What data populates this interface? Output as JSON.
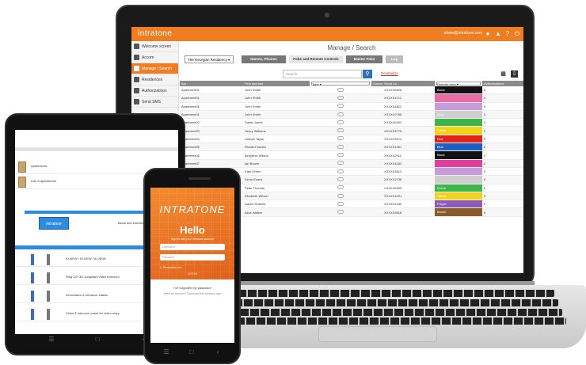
{
  "laptop": {
    "app": {
      "logo": "intratone",
      "user": "olivier@intratone.com",
      "sidebar": [
        {
          "label": "Welcome screen",
          "active": false
        },
        {
          "label": "Accom",
          "active": false
        },
        {
          "label": "Manage / Search",
          "active": true
        },
        {
          "label": "Residences",
          "active": false
        },
        {
          "label": "Authorizations",
          "active": false
        },
        {
          "label": "Send SMS",
          "active": false
        }
      ],
      "page_title": "Manage / Search",
      "filter_select": "The Georgian Residency",
      "tabs": [
        "Names, Phones",
        "Fobs and Remote Controls",
        "Master Fobs",
        "Log"
      ],
      "search_placeholder": "Search",
      "reset_link": "Reinitialize",
      "table": {
        "headers": [
          "Apt.",
          "First and last",
          "Type",
          "Comment",
          "Serial no.",
          "Remote color",
          "Authorizations"
        ],
        "rows": [
          {
            "apt": "Apartment01",
            "name": "John Smith",
            "type": "",
            "serial": "XXXXX6326",
            "color_label": "Black",
            "color": "#111111",
            "auth": "0"
          },
          {
            "apt": "Apartment01",
            "name": "John Smith",
            "type": "",
            "serial": "XXXXX4711",
            "color_label": "",
            "color": "#e86aa3",
            "auth": "0"
          },
          {
            "apt": "Apartment01",
            "name": "John Smith",
            "type": "",
            "serial": "XXXXX4822",
            "color_label": "",
            "color": "#c79ad9",
            "auth": "0"
          },
          {
            "apt": "Apartment01",
            "name": "John Smith",
            "type": "",
            "serial": "XXXXX2798",
            "color_label": "Grey",
            "color": "#cfcfcf",
            "auth": "0"
          },
          {
            "apt": "Apartment02",
            "name": "Sarah Jones",
            "type": "",
            "serial": "XXXXX6402",
            "color_label": "",
            "color": "#3db54a",
            "auth": "0"
          },
          {
            "apt": "Apartment03",
            "name": "Henry Williams",
            "type": "",
            "serial": "XXXXX4775",
            "color_label": "Yellow",
            "color": "#f2d31b",
            "auth": "0"
          },
          {
            "apt": "Apartment04",
            "name": "Joseph Taylor",
            "type": "",
            "serial": "XXXXX3374",
            "color_label": "Red",
            "color": "#e2231a",
            "auth": "0"
          },
          {
            "apt": "Apartment05",
            "name": "Richard Davies",
            "type": "",
            "serial": "XXXXX4461",
            "color_label": "Blue",
            "color": "#1f5fbf",
            "auth": "0"
          },
          {
            "apt": "Apartment06",
            "name": "Benjamin Wilson",
            "type": "",
            "serial": "XXXXX2911",
            "color_label": "Black",
            "color": "#111111",
            "auth": "0"
          },
          {
            "apt": "Apartment07",
            "name": "Ian Brown",
            "type": "",
            "serial": "XXXXX4182",
            "color_label": "",
            "color": "#e23f9c",
            "auth": "0"
          },
          {
            "apt": "Apartment08",
            "name": "Kate Green",
            "type": "",
            "serial": "XXXXX5613",
            "color_label": "",
            "color": "#c79ad9",
            "auth": "0"
          },
          {
            "apt": "Apartment09",
            "name": "Kevin Evans",
            "type": "",
            "serial": "XXXXX2738",
            "color_label": "",
            "color": "#cfcfcf",
            "auth": "0"
          },
          {
            "apt": "Apartment10",
            "name": "Peter Thomas",
            "type": "",
            "serial": "XXXXX6099",
            "color_label": "Green",
            "color": "#3db54a",
            "auth": "0"
          },
          {
            "apt": "Apartment11",
            "name": "Elizabeth Wilson",
            "type": "",
            "serial": "XXXXX4291",
            "color_label": "Yellow",
            "color": "#f2d31b",
            "auth": "0"
          },
          {
            "apt": "Apartment12",
            "name": "Daniel Roberts",
            "type": "",
            "serial": "XXXXX4430",
            "color_label": "Purple",
            "color": "#8e5bb5",
            "auth": "0"
          },
          {
            "apt": "Apartment13",
            "name": "Alice Walker",
            "type": "",
            "serial": "XXXXX5518",
            "color_label": "Brown",
            "color": "#8b5a2b",
            "auth": "0"
          }
        ]
      }
    }
  },
  "tablet": {
    "items": [
      {
        "label": "Apartments"
      },
      {
        "label": "List of apartments"
      }
    ],
    "banner_logo": "intratone",
    "banner_text": "Block and entrance",
    "products": [
      {
        "label": "ID-NEW / ID-NEW / ID-NEW"
      },
      {
        "label": "Ring 2G+3G compliant video intercom"
      },
      {
        "label": "Information & entrance station"
      },
      {
        "label": "Video & intercom panel for video entry"
      }
    ]
  },
  "phone": {
    "logo": "INTRATONE",
    "greeting": "Hello",
    "subtitle": "Sign in with your Intratone account",
    "username_placeholder": "Username",
    "password_placeholder": "Password",
    "remember": "Remember me",
    "login_button": "LOG IN",
    "forgot": "I've forgotten my password",
    "note": "Need an account? Download the Intratone App"
  },
  "colors": {
    "brand_orange": "#ef7d22",
    "search_blue": "#2f6fb5"
  }
}
